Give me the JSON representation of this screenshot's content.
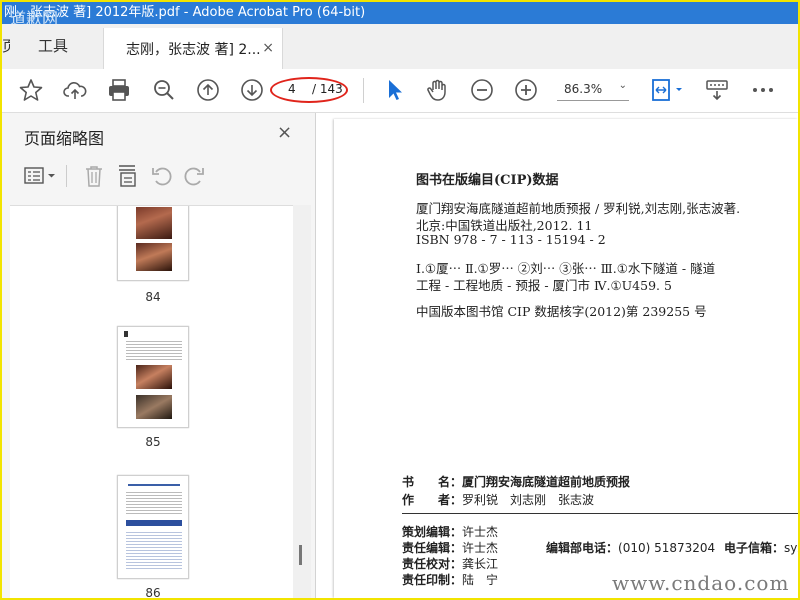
{
  "window": {
    "title": "刚，张志波 著] 2012年版.pdf - Adobe Acrobat Pro (64-bit)"
  },
  "menu": {
    "home_label": "页",
    "tools_label": "工具"
  },
  "tab": {
    "label": "志刚，张志波 著] 2...",
    "close": "×"
  },
  "toolbar": {
    "page_current": "4",
    "page_total": "/ 143",
    "zoom": "86.3%"
  },
  "panel": {
    "title": "页面缩略图",
    "close": "×",
    "thumbnails": [
      {
        "label": "84"
      },
      {
        "label": "85"
      },
      {
        "label": "86"
      }
    ]
  },
  "document": {
    "cip_heading": "图书在版编目(CIP)数据",
    "cip_lines": [
      "厦门翔安海底隧道超前地质预报 / 罗利锐,刘志刚,张志波著.",
      "北京:中国铁道出版社,2012. 11",
      "ISBN 978 - 7 - 113 - 15194 - 2",
      "Ⅰ.①厦⋯ Ⅱ.①罗⋯ ②刘⋯ ③张⋯ Ⅲ.①水下隧道 - 隧道",
      "工程 - 工程地质 - 预报 - 厦门市 Ⅳ.①U459. 5",
      "中国版本图书馆 CIP 数据核字(2012)第 239255 号"
    ],
    "book_name_label": "书　　名：",
    "book_name": "厦门翔安海底隧道超前地质预报",
    "author_label": "作　　者：",
    "authors": "罗利锐　刘志刚　张志波",
    "planning_editor_label": "策划编辑：",
    "planning_editor": "许士杰",
    "responsible_editor_label": "责任编辑：",
    "responsible_editor": "许士杰",
    "dept_phone_label": "编辑部电话：",
    "dept_phone": "(010) 51873204",
    "email_label": "电子信箱：",
    "email": "syx",
    "proofreader_label": "责任校对：",
    "proofreader": "龚长江",
    "printer_label": "责任印制：",
    "printer": "陆　宁"
  },
  "watermarks": {
    "top_left": "道歉网",
    "bottom_right": "www.cndao.com"
  }
}
